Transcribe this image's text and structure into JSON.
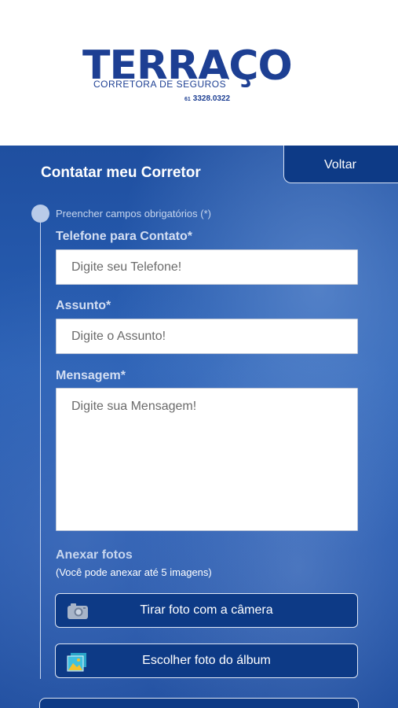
{
  "header": {
    "logo": {
      "main": "TERRAÇO",
      "sub": "CORRETORA DE SEGUROS",
      "phone_prefix": "61",
      "phone": "3328.0322"
    }
  },
  "page": {
    "title": "Contatar meu Corretor",
    "back_label": "Voltar"
  },
  "form": {
    "required_note": "Preencher campos obrigatórios (*)",
    "phone": {
      "label": "Telefone para Contato*",
      "placeholder": "Digite seu Telefone!"
    },
    "subject": {
      "label": "Assunto*",
      "placeholder": "Digite o Assunto!"
    },
    "message": {
      "label": "Mensagem*",
      "placeholder": "Digite sua Mensagem!"
    }
  },
  "attachments": {
    "title": "Anexar fotos",
    "hint": "(Você pode anexar até 5 imagens)",
    "camera_button": {
      "label": "Tirar foto com a câmera",
      "icon": "camera-icon"
    },
    "album_button": {
      "label": "Escolher foto do álbum",
      "icon": "photo-album-icon"
    }
  },
  "colors": {
    "brand": "#1d3f93",
    "button_bg": "#0d3a86",
    "panel_bg": "#2457ad"
  }
}
